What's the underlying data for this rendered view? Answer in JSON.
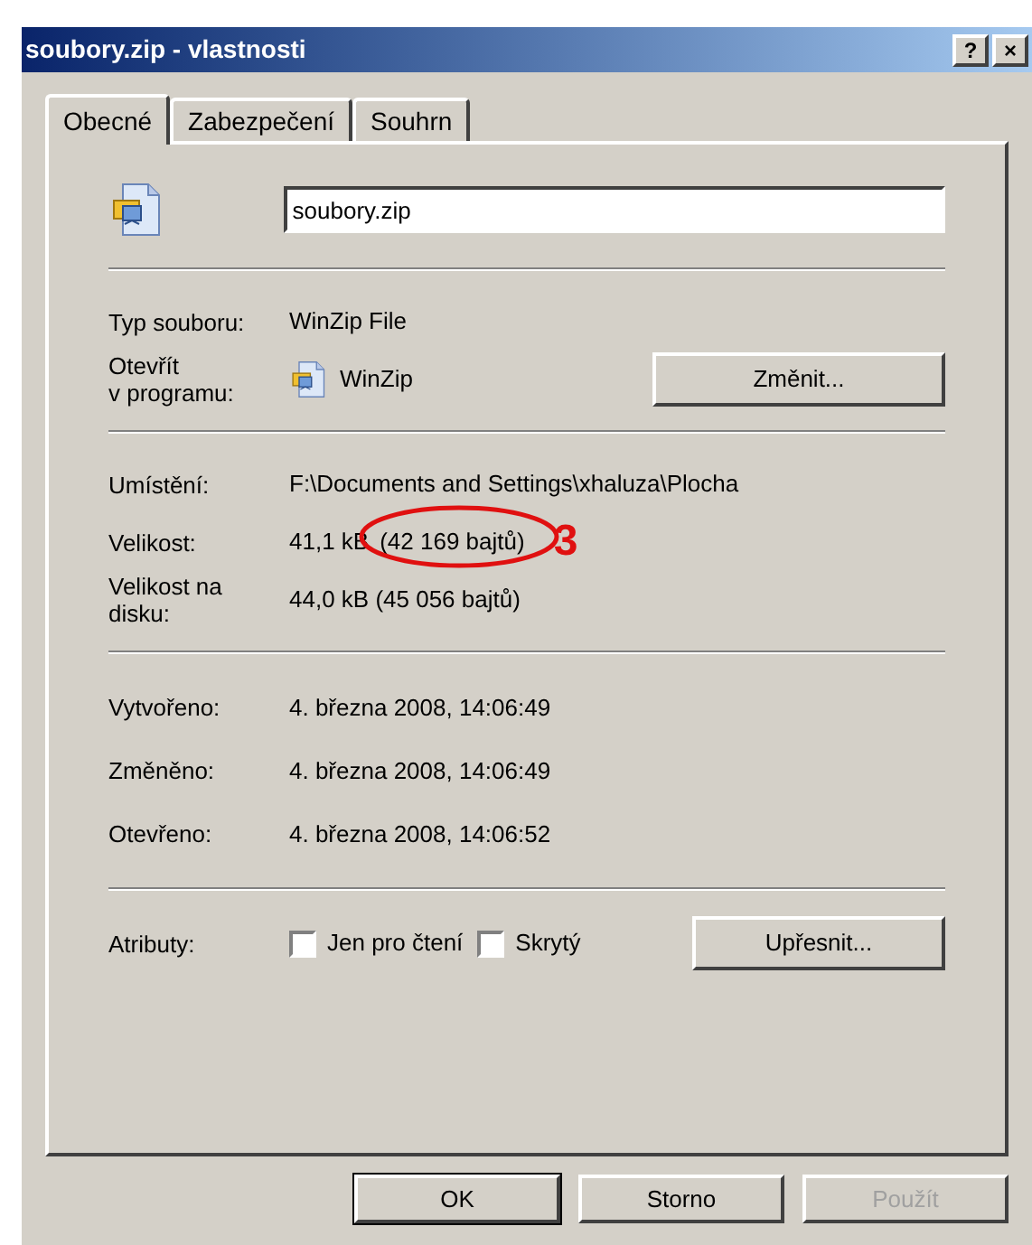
{
  "window": {
    "title": "soubory.zip - vlastnosti",
    "title_buttons": [
      "?",
      "×"
    ]
  },
  "tabs": [
    {
      "label": "Obecné",
      "selected": true
    },
    {
      "label": "Zabezpečení",
      "selected": false
    },
    {
      "label": "Souhrn",
      "selected": false
    }
  ],
  "file_name": {
    "value": "soubory.zip"
  },
  "type_section": [
    {
      "label": "Typ souboru:",
      "value": "WinZip File",
      "kind": "text"
    },
    {
      "label": "Otevřít\nv programu:",
      "value": "WinZip",
      "kind": "program",
      "button": "Změnit..."
    }
  ],
  "location_section": [
    {
      "label": "Umístění:",
      "value": "F:\\Documents and Settings\\xhaluza\\Plocha"
    },
    {
      "label": "Velikost:",
      "value": "41,1 kB",
      "value_extra": "(42 169 bajtů)",
      "annotation": "3"
    },
    {
      "label": "Velikost na\ndisku:",
      "value": "44,0 kB (45 056 bajtů)"
    }
  ],
  "dates_section": [
    {
      "label": "Vytvořeno:",
      "value": "4. března 2008, 14:06:49"
    },
    {
      "label": "Změněno:",
      "value": "4. března 2008, 14:06:49"
    },
    {
      "label": "Otevřeno:",
      "value": "4. března 2008, 14:06:52"
    }
  ],
  "attributes": {
    "label": "Atributy:",
    "checkboxes": [
      {
        "label": "Jen pro čtení",
        "checked": false
      },
      {
        "label": "Skrytý",
        "checked": false
      }
    ],
    "button": "Upřesnit..."
  },
  "buttons": [
    {
      "label": "OK",
      "default": true,
      "disabled": false
    },
    {
      "label": "Storno",
      "default": false,
      "disabled": false
    },
    {
      "label": "Použít",
      "default": false,
      "disabled": true
    }
  ]
}
